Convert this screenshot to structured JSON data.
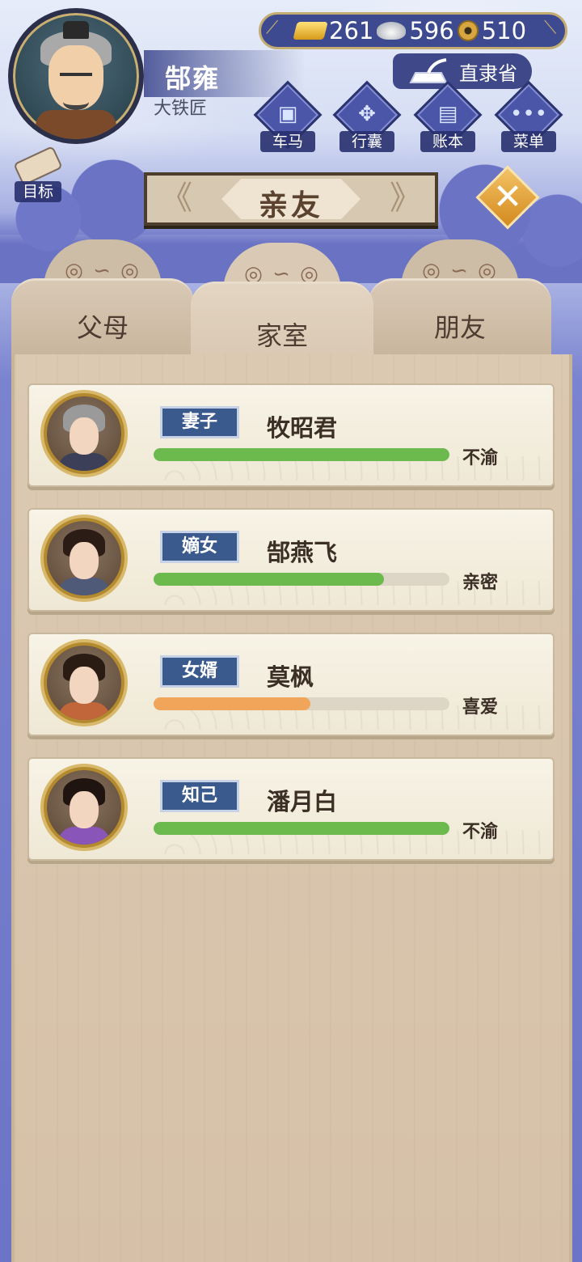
{
  "player": {
    "name": "郜雍",
    "title": "大铁匠"
  },
  "currency": {
    "gold": "261",
    "silver": "596",
    "coins": "510"
  },
  "location": "直隶省",
  "quick_menu": [
    {
      "label": "车马",
      "icon": "carriage-icon"
    },
    {
      "label": "行囊",
      "icon": "bundle-icon"
    },
    {
      "label": "账本",
      "icon": "ledger-icon"
    },
    {
      "label": "菜单",
      "icon": "more-icon"
    }
  ],
  "goal_label": "目标",
  "page_title": "亲友",
  "tabs": [
    {
      "label": "父母",
      "active": false
    },
    {
      "label": "家室",
      "active": true
    },
    {
      "label": "朋友",
      "active": false
    }
  ],
  "relatives": [
    {
      "role": "妻子",
      "name": "牧昭君",
      "bond": "不渝",
      "progress": 1.0,
      "bar_color": "#6cba4e",
      "hair": "#9a9a9a",
      "robe": "#3b3f58"
    },
    {
      "role": "嫡女",
      "name": "郜燕飞",
      "bond": "亲密",
      "progress": 0.78,
      "bar_color": "#6cba4e",
      "hair": "#2b1d16",
      "robe": "#4f5a78"
    },
    {
      "role": "女婿",
      "name": "莫枫",
      "bond": "喜爱",
      "progress": 0.53,
      "bar_color": "#f0a55b",
      "hair": "#2a1c12",
      "robe": "#c0663a"
    },
    {
      "role": "知己",
      "name": "潘月白",
      "bond": "不渝",
      "progress": 1.0,
      "bar_color": "#6cba4e",
      "hair": "#1f1410",
      "robe": "#8a55b8"
    }
  ],
  "colors": {
    "accent_blue": "#3a5a8e",
    "progress_green": "#6cba4e",
    "progress_orange": "#f0a55b"
  }
}
